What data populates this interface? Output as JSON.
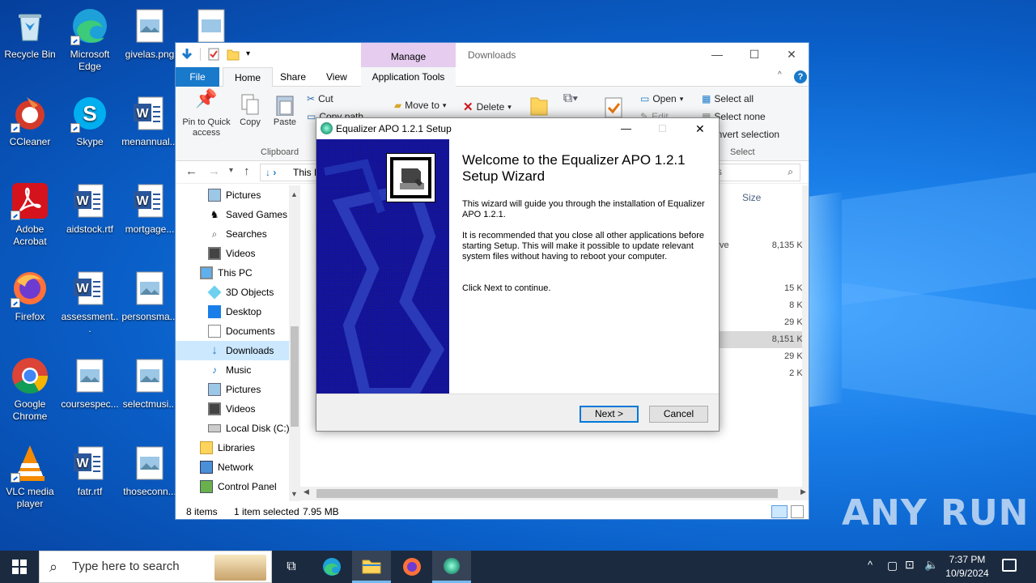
{
  "desktop": {
    "icons": [
      {
        "label": "Recycle Bin"
      },
      {
        "label": "Microsoft Edge"
      },
      {
        "label": "givelas.png"
      },
      {
        "label": "CCleaner"
      },
      {
        "label": "Skype"
      },
      {
        "label": "menannual..."
      },
      {
        "label": "Adobe Acrobat"
      },
      {
        "label": "aidstock.rtf"
      },
      {
        "label": "mortgage..."
      },
      {
        "label": "Firefox"
      },
      {
        "label": "assessment..."
      },
      {
        "label": "personsma..."
      },
      {
        "label": "Google Chrome"
      },
      {
        "label": "coursespec..."
      },
      {
        "label": "selectmusi..."
      },
      {
        "label": "VLC media player"
      },
      {
        "label": "fatr.rtf"
      },
      {
        "label": "thoseconn..."
      }
    ],
    "watermark": "ANY RUN"
  },
  "explorer": {
    "title": "Downloads",
    "manage_tab": "Manage",
    "tabs": {
      "file": "File",
      "home": "Home",
      "share": "Share",
      "view": "View",
      "app_tools": "Application Tools"
    },
    "ribbon": {
      "pin": "Pin to Quick access",
      "copy": "Copy",
      "paste": "Paste",
      "cut": "Cut",
      "copy_path": "Copy path",
      "clipboard_group": "Clipboard",
      "move_to": "Move to",
      "delete": "Delete",
      "open": "Open",
      "edit": "Edit",
      "select_all": "Select all",
      "select_none": "Select none",
      "invert_selection": "Invert selection",
      "select_group": "Select"
    },
    "address": "This PC",
    "column_size": "Size",
    "nav_items": [
      {
        "label": "Pictures",
        "icon": "pictures-icon"
      },
      {
        "label": "Saved Games",
        "icon": "saved-games-icon"
      },
      {
        "label": "Searches",
        "icon": "searches-icon"
      },
      {
        "label": "Videos",
        "icon": "videos-icon"
      },
      {
        "label": "This PC",
        "icon": "this-pc-icon"
      },
      {
        "label": "3D Objects",
        "icon": "3d-objects-icon"
      },
      {
        "label": "Desktop",
        "icon": "desktop-folder-icon"
      },
      {
        "label": "Documents",
        "icon": "documents-icon"
      },
      {
        "label": "Downloads",
        "icon": "downloads-icon"
      },
      {
        "label": "Music",
        "icon": "music-icon"
      },
      {
        "label": "Pictures",
        "icon": "pictures-icon"
      },
      {
        "label": "Videos",
        "icon": "videos-icon"
      },
      {
        "label": "Local Disk (C:)",
        "icon": "local-disk-icon"
      },
      {
        "label": "Libraries",
        "icon": "libraries-icon"
      },
      {
        "label": "Network",
        "icon": "network-icon"
      },
      {
        "label": "Control Panel",
        "icon": "control-panel-icon"
      }
    ],
    "files": [
      {
        "type": "ve",
        "size": "8,135 KB"
      },
      {
        "type": "",
        "size": "15 KB"
      },
      {
        "type": "",
        "size": "8 KB"
      },
      {
        "type": "",
        "size": "29 KB"
      },
      {
        "type": "",
        "size": "8,151 KB"
      },
      {
        "type": "",
        "size": "29 KB"
      },
      {
        "type": "",
        "size": "2 KB"
      }
    ],
    "status": {
      "items": "8 items",
      "selected": "1 item selected",
      "size": "7.95 MB"
    }
  },
  "dialog": {
    "title": "Equalizer APO 1.2.1 Setup",
    "heading": "Welcome to the Equalizer APO 1.2.1 Setup Wizard",
    "para1": "This wizard will guide you through the installation of Equalizer APO 1.2.1.",
    "para2": "It is recommended that you close all other applications before starting Setup. This will make it possible to update relevant system files without having to reboot your computer.",
    "para3": "Click Next to continue.",
    "next": "Next >",
    "cancel": "Cancel"
  },
  "taskbar": {
    "search_placeholder": "Type here to search",
    "time": "7:37 PM",
    "date": "10/9/2024"
  },
  "colors": {
    "accent": "#1979ca",
    "manage_tab": "#e6cdf0",
    "taskbar": "#1b2a3f"
  }
}
